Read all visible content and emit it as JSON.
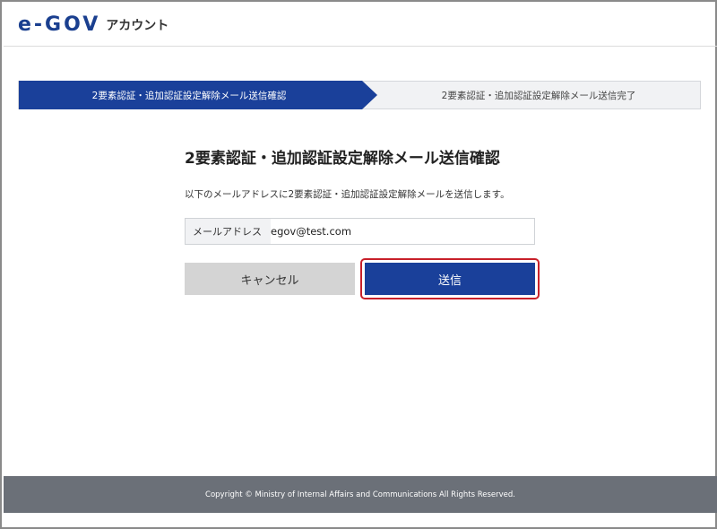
{
  "header": {
    "logo_text": "e-GOV",
    "logo_subtitle": "アカウント"
  },
  "steps": [
    {
      "label": "2要素認証・追加認証設定解除メール送信確認",
      "active": true
    },
    {
      "label": "2要素認証・追加認証設定解除メール送信完了",
      "active": false
    }
  ],
  "main": {
    "title": "2要素認証・追加認証設定解除メール送信確認",
    "description": "以下のメールアドレスに2要素認証・追加認証設定解除メールを送信します。",
    "email_field": {
      "label": "メールアドレス",
      "value": "egov@test.com"
    },
    "cancel_label": "キャンセル",
    "send_label": "送信"
  },
  "footer": {
    "copyright": "Copyright © Ministry of Internal Affairs and Communications All Rights Reserved."
  },
  "colors": {
    "primary": "#1a409a",
    "highlight": "#c8202a",
    "footer_bg": "#6b7078"
  }
}
